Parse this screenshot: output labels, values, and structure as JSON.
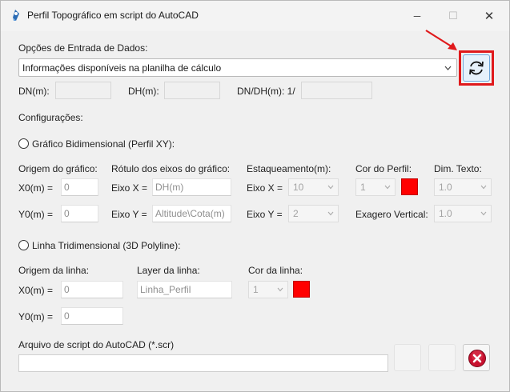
{
  "window": {
    "title": "Perfil Topográfico em script do AutoCAD",
    "minimize": "─",
    "maximize": "☐",
    "close": "✕"
  },
  "input_options": {
    "heading": "Opções de Entrada de Dados:",
    "selected": "Informações disponíveis na planilha de cálculo",
    "refresh_icon": "refresh-icon"
  },
  "scale": {
    "dn_label": "DN(m):",
    "dn_value": "",
    "dh_label": "DH(m):",
    "dh_value": "",
    "ratio_label": "DN/DH(m): 1/",
    "ratio_value": ""
  },
  "config_heading": "Configurações:",
  "profile2d": {
    "radio_label": "Gráfico Bidimensional (Perfil XY):",
    "origin_heading": "Origem do gráfico:",
    "x0_label": "X0(m) =",
    "x0_value": "0",
    "y0_label": "Y0(m) =",
    "y0_value": "0",
    "axis_heading": "Rótulo dos eixos do gráfico:",
    "axis_x_label": "Eixo X =",
    "axis_x_value": "DH(m)",
    "axis_y_label": "Eixo Y =",
    "axis_y_value": "Altitude\\Cota(m)",
    "station_heading": "Estaqueamento(m):",
    "station_x_label": "Eixo X =",
    "station_x_value": "10",
    "station_y_label": "Eixo Y =",
    "station_y_value": "2",
    "color_heading": "Cor do Perfil:",
    "color_value": "1",
    "color_swatch": "#ff0000",
    "exag_label": "Exagero Vertical:",
    "exag_value": "1.0",
    "text_heading": "Dim. Texto:",
    "text_value": "1.0"
  },
  "polyline3d": {
    "radio_label": "Linha Tridimensional (3D Polyline):",
    "origin_heading": "Origem da linha:",
    "x0_label": "X0(m) =",
    "x0_value": "0",
    "y0_label": "Y0(m) =",
    "y0_value": "0",
    "layer_heading": "Layer da linha:",
    "layer_value": "Linha_Perfil",
    "color_heading": "Cor da linha:",
    "color_value": "1",
    "color_swatch": "#ff0000"
  },
  "script_file": {
    "label": "Arquivo de script do AutoCAD (*.scr)",
    "path_value": "",
    "cancel_icon": "cancel-icon"
  },
  "colors": {
    "annotation_red": "#e0191b",
    "refresh_icon_bg": "#e6f1fb"
  }
}
